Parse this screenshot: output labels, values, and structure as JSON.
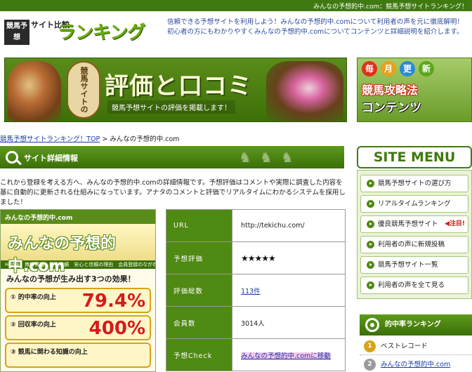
{
  "topbar": {
    "text": "みんなの予想的中.com：競馬予想サイトランキング！"
  },
  "header": {
    "logo_box": "競馬予想",
    "logo_small": "サイト比較",
    "logo_big": "ランキング",
    "description": "信頼できる予想サイトを利用しよう！みんなの予想的中.comについて利用者の声を元に徹底解明！初心者の方にもわかりやすくみんなの予想的中.comについてコンテンツと詳細説明を紹介します。"
  },
  "banner_main": {
    "badge": "競馬サイトの",
    "title": "評価と口コミ",
    "subtitle": "競馬予想サイトの評価を掲載します！"
  },
  "banner_side": {
    "dots": [
      {
        "char": "毎",
        "color": "#e0311a"
      },
      {
        "char": "月",
        "color": "#e6a21a"
      },
      {
        "char": "更",
        "color": "#2a8ad8"
      },
      {
        "char": "新",
        "color": "#5aa81a"
      }
    ],
    "line1": "競馬攻略法",
    "line2": "コンテンツ"
  },
  "breadcrumb": {
    "link": "競馬予想サイトランキング！TOP",
    "separator": " > ",
    "current": "みんなの予想的中.com"
  },
  "section": {
    "title": "サイト詳細情報"
  },
  "intro": "これから登録を考える方へ、みんなの予想的中.comの詳細情報です。予想評価はコメントや実際に調査した内容を基に自動的に更新される仕組みになっています。アナタのコメントと評価でリアルタイムにわかるシステムを採用しました！",
  "thumbnail": {
    "top": "みんなの予想的中.com",
    "logo": "みんなの予想的中.com",
    "nav": "HOME　無料情報　的中実績　安心と信頼の理由　会員登録のながれ",
    "headline": "みんなの予想が生み出す3つの効果！",
    "stats": [
      {
        "label": "① 的中率の向上",
        "value": "79.4%"
      },
      {
        "label": "② 回収率の向上",
        "value": "400%"
      },
      {
        "label": "③ 競馬に関わる知識の向上",
        "value": ""
      }
    ]
  },
  "details": {
    "rows": [
      {
        "key": "URL",
        "value": "http://tekichu.com/"
      },
      {
        "key": "予想評価",
        "value": "★★★★★"
      },
      {
        "key": "評価総数",
        "value": "113件"
      },
      {
        "key": "会員数",
        "value": "3014人"
      },
      {
        "key": "予想Check",
        "value": "みんなの予想的中.comに移動"
      }
    ]
  },
  "menu": {
    "title": "SITE MENU",
    "items": [
      {
        "label": "競馬予想サイトの選び方",
        "note": ""
      },
      {
        "label": "リアルタイムランキング",
        "note": ""
      },
      {
        "label": "優良競馬予想サイト",
        "note": "◀注目!"
      },
      {
        "label": "利用者の声に新規投稿",
        "note": ""
      },
      {
        "label": "競馬予想サイト一覧",
        "note": ""
      },
      {
        "label": "利用者の声を全て見る",
        "note": ""
      }
    ]
  },
  "ranking": {
    "title": "的中率ランキング",
    "items": [
      {
        "rank": "1",
        "label": "ベストレコード",
        "color": "#d9a21a"
      },
      {
        "rank": "2",
        "label": "みんなの予想的中.com",
        "color": "#9a9a9a"
      }
    ]
  }
}
